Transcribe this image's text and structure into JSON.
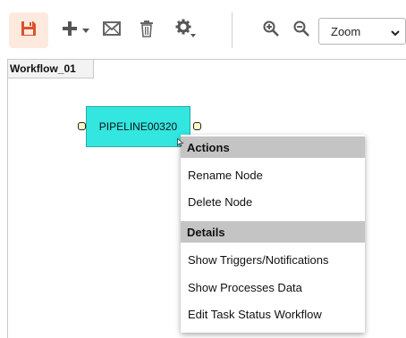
{
  "toolbar": {
    "icons": [
      "save-icon",
      "plus-icon",
      "chevron-down-icon",
      "mail-icon",
      "trash-icon",
      "gear-icon",
      "zoom-in-icon",
      "zoom-out-icon"
    ],
    "zoom_select_value": "Zoom",
    "accent_color": "#d9532b"
  },
  "workflow": {
    "tab_label": "Workflow_01"
  },
  "node": {
    "label": "PIPELINE00320",
    "color": "#33e6e0"
  },
  "context_menu": {
    "actions_header": "Actions",
    "actions_items": [
      "Rename Node",
      "Delete Node"
    ],
    "details_header": "Details",
    "details_items": [
      "Show Triggers/Notifications",
      "Show Processes Data",
      "Edit Task Status Workflow"
    ]
  }
}
